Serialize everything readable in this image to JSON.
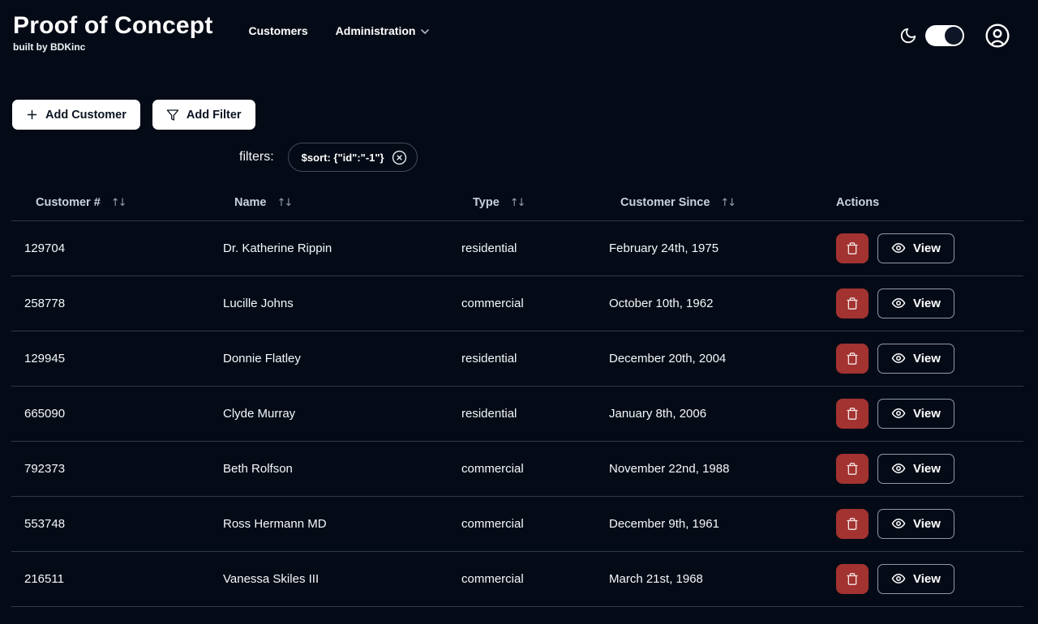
{
  "app": {
    "title": "Proof of Concept",
    "subtitle": "built by BDKinc"
  },
  "nav": {
    "customers_label": "Customers",
    "administration_label": "Administration"
  },
  "toolbar": {
    "add_customer_label": "Add Customer",
    "add_filter_label": "Add Filter"
  },
  "filters": {
    "label": "filters:",
    "chips": [
      {
        "text": "$sort: {\"id\":\"-1\"}"
      }
    ]
  },
  "table": {
    "sort_glyph": "↑↓",
    "columns": [
      {
        "label": "Customer #",
        "sortable": true
      },
      {
        "label": "Name",
        "sortable": true
      },
      {
        "label": "Type",
        "sortable": true
      },
      {
        "label": "Customer Since",
        "sortable": true
      },
      {
        "label": "Actions",
        "sortable": false
      }
    ],
    "view_label": "View",
    "rows": [
      {
        "customer_number": "129704",
        "name": "Dr. Katherine Rippin",
        "type": "residential",
        "customer_since": "February 24th, 1975"
      },
      {
        "customer_number": "258778",
        "name": "Lucille Johns",
        "type": "commercial",
        "customer_since": "October 10th, 1962"
      },
      {
        "customer_number": "129945",
        "name": "Donnie Flatley",
        "type": "residential",
        "customer_since": "December 20th, 2004"
      },
      {
        "customer_number": "665090",
        "name": "Clyde Murray",
        "type": "residential",
        "customer_since": "January 8th, 2006"
      },
      {
        "customer_number": "792373",
        "name": "Beth Rolfson",
        "type": "commercial",
        "customer_since": "November 22nd, 1988"
      },
      {
        "customer_number": "553748",
        "name": "Ross Hermann MD",
        "type": "commercial",
        "customer_since": "December 9th, 1961"
      },
      {
        "customer_number": "216511",
        "name": "Vanessa Skiles III",
        "type": "commercial",
        "customer_since": "March 21st, 1968"
      }
    ]
  },
  "colors": {
    "background": "#050b16",
    "divider": "#2e3948",
    "delete_button": "#a23331",
    "header_text": "#c7d2e0",
    "light_button_bg": "#ffffff",
    "light_button_text": "#0c1422"
  }
}
